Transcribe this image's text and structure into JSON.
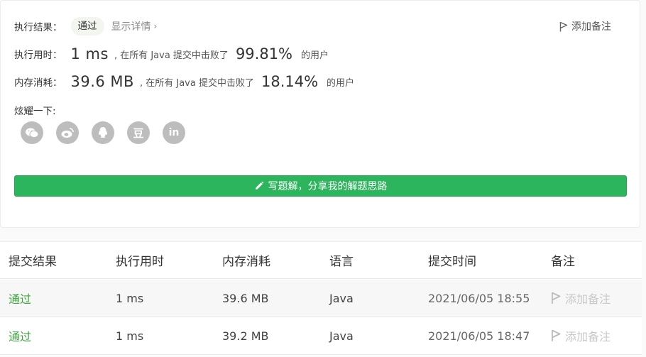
{
  "result": {
    "label": "执行结果：",
    "status": "通过",
    "detail_link": "显示详情",
    "add_note": "添加备注"
  },
  "runtime": {
    "label": "执行用时：",
    "value": "1 ms",
    "middle": ", 在所有 Java 提交中击败了",
    "percent": "99.81%",
    "tail": "的用户"
  },
  "memory": {
    "label": "内存消耗：",
    "value": "39.6 MB",
    "middle": ", 在所有 Java 提交中击败了",
    "percent": "18.14%",
    "tail": "的用户"
  },
  "share": {
    "label": "炫耀一下:",
    "icons": [
      "wechat-icon",
      "weibo-icon",
      "qq-icon",
      "douban-icon",
      "linkedin-icon"
    ],
    "douban_glyph": "豆",
    "linkedin_glyph": "in"
  },
  "write_button": {
    "label": "写题解，分享我的解题思路"
  },
  "submissions": {
    "headers": [
      "提交结果",
      "执行用时",
      "内存消耗",
      "语言",
      "提交时间",
      "备注"
    ],
    "rows": [
      {
        "status": "通过",
        "runtime": "1 ms",
        "memory": "39.6 MB",
        "language": "Java",
        "time": "2021/06/05 18:55",
        "note": "添加备注"
      },
      {
        "status": "通过",
        "runtime": "1 ms",
        "memory": "39.2 MB",
        "language": "Java",
        "time": "2021/06/05 18:47",
        "note": "添加备注"
      }
    ]
  },
  "colors": {
    "accent_green": "#2db55d",
    "status_green": "#3ea63e",
    "icon_gray": "#bdbdbd"
  }
}
